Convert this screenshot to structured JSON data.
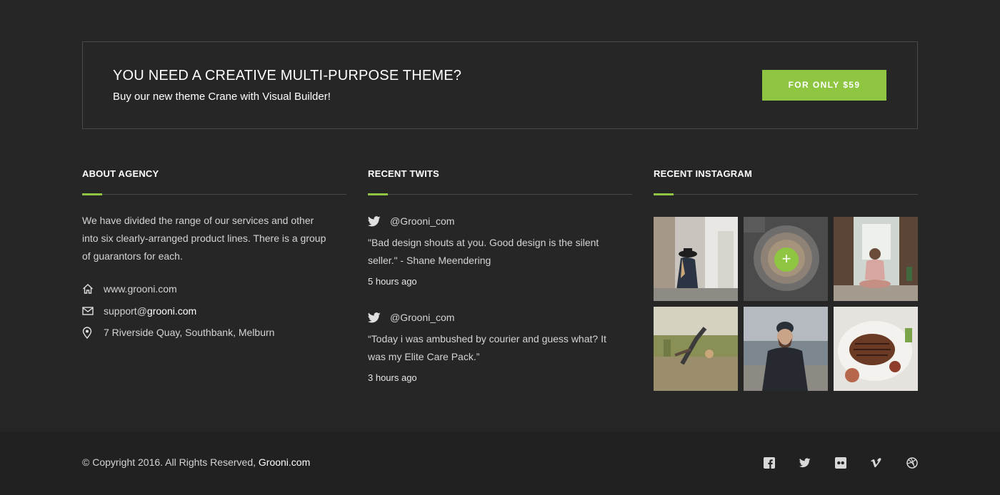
{
  "cta": {
    "title": "YOU NEED A CREATIVE MULTI-PURPOSE THEME?",
    "subtitle": "Buy our new theme Crane with Visual Builder!",
    "button_label": "FOR ONLY $59",
    "accent_color": "#8ec641"
  },
  "about": {
    "title": "ABOUT AGENCY",
    "text": "We have divided the range of our services and other into six  clearly-arranged product lines. There is a group of guarantors for each.",
    "website": "www.grooni.com",
    "email_prefix": "support@",
    "email_domain": "grooni.com",
    "address": "7 Riverside Quay, Southbank, Melburn"
  },
  "twits": {
    "title": "RECENT TWITS",
    "items": [
      {
        "handle": "@Grooni_com",
        "text": "\"Bad design shouts at you. Good design is the silent seller.\" - Shane Meendering",
        "time": "5 hours ago"
      },
      {
        "handle": "@Grooni_com",
        "text": "“Today i was ambushed by courier and guess what? It was my Elite Care Pack.”",
        "time": "3 hours ago"
      }
    ]
  },
  "instagram": {
    "title": "RECENT INSTAGRAM",
    "hover_icon": "plus-icon",
    "images": [
      "woman-walking-street",
      "latte-coffee-cup",
      "woman-yoga-doorway",
      "child-cartwheel-field",
      "man-beanie-lake",
      "grilled-steak-plate"
    ]
  },
  "footer": {
    "copyright_prefix": "© Copyright 2016. All Rights Reserved, ",
    "copyright_brand": "Grooni.com",
    "social": [
      "facebook-icon",
      "twitter-icon",
      "flickr-icon",
      "vimeo-icon",
      "dribbble-icon"
    ]
  }
}
